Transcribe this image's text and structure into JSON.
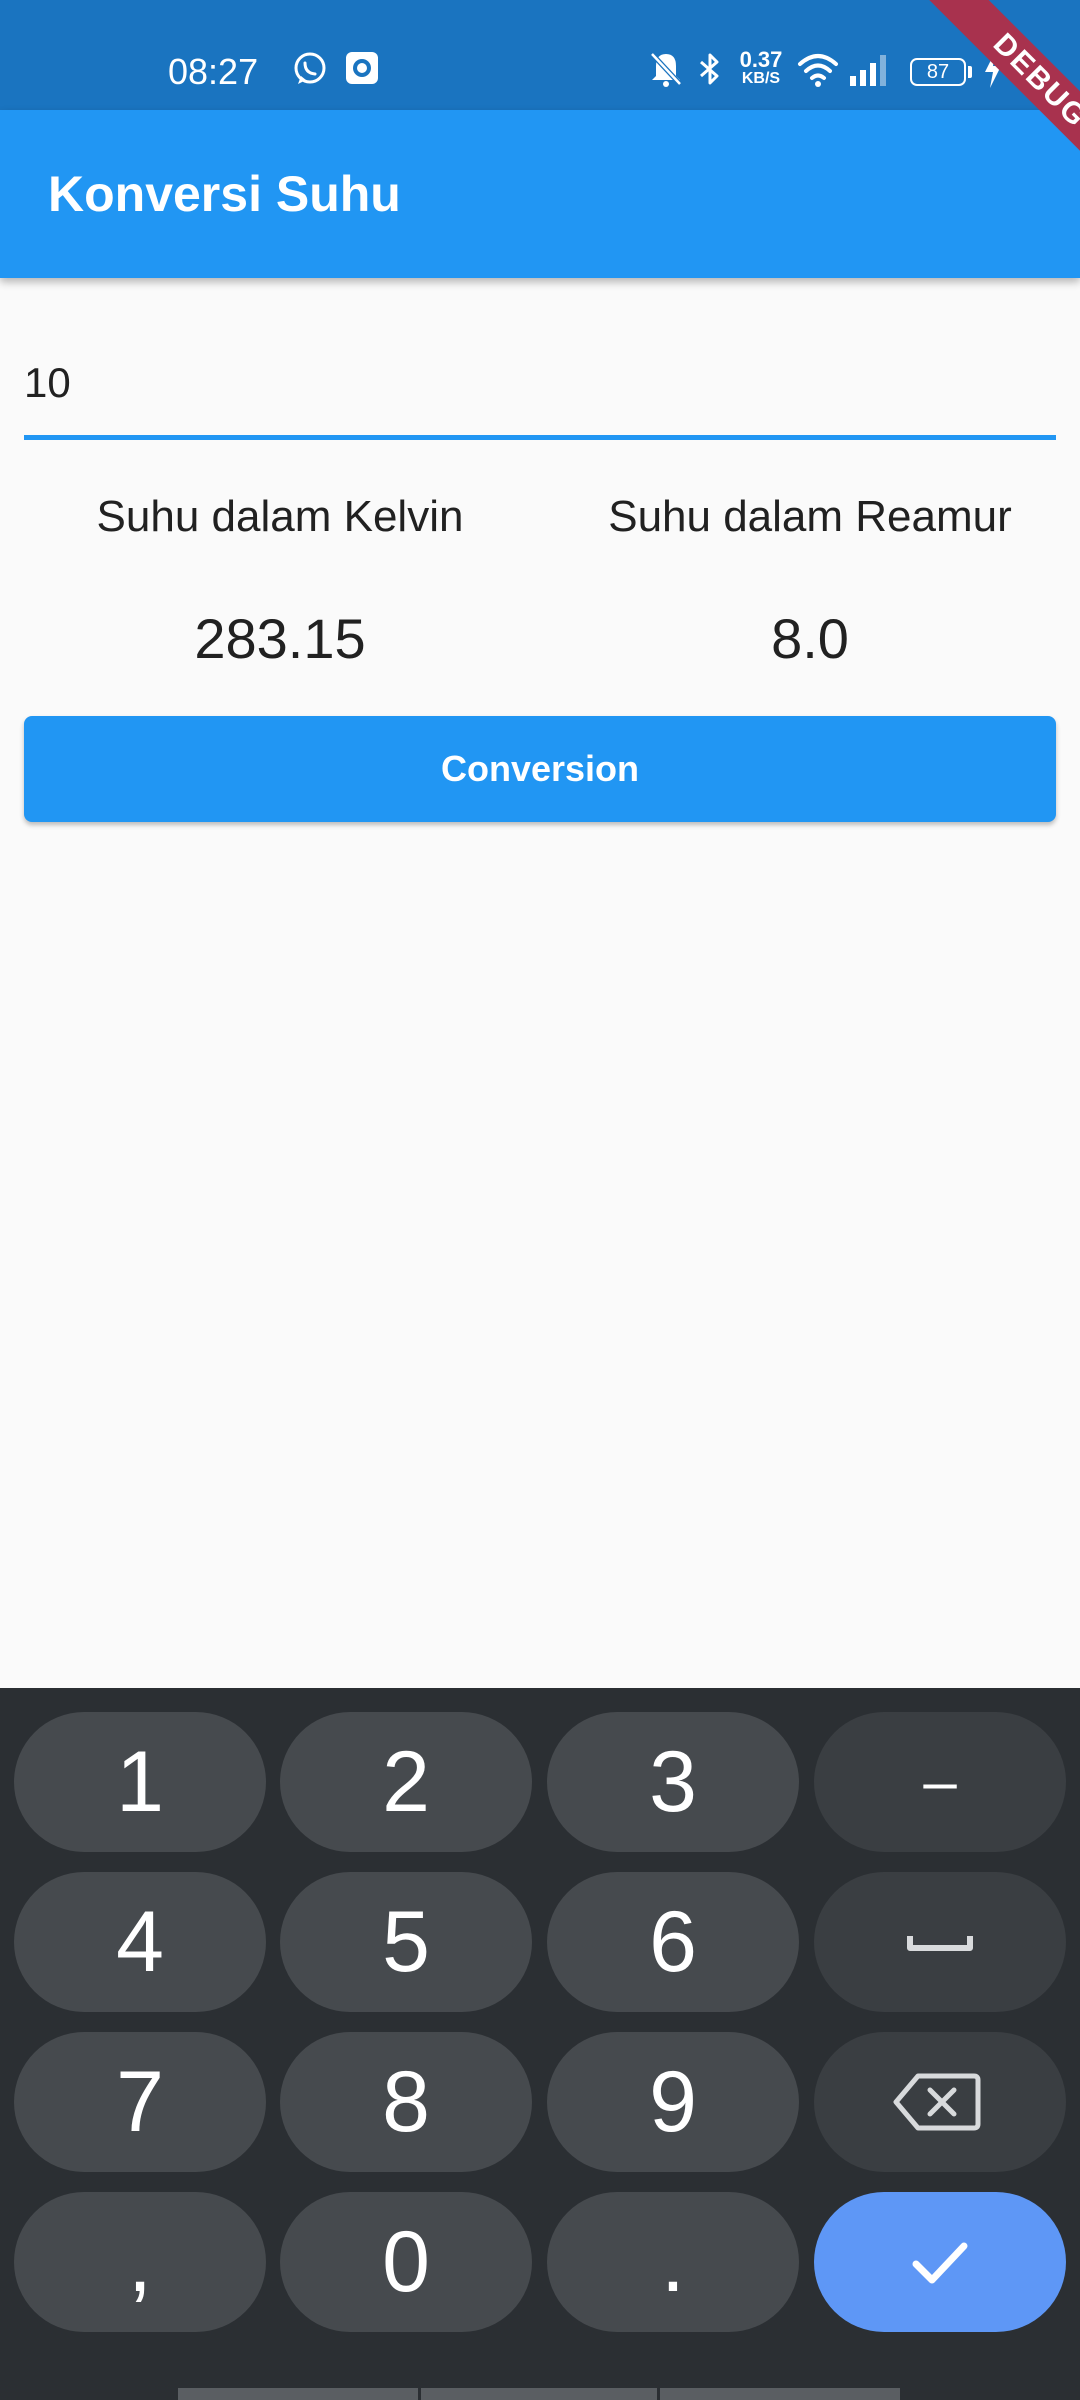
{
  "status_bar": {
    "time": "08:27",
    "speed_value": "0.37",
    "speed_unit": "KB/S",
    "battery": "87",
    "icons": [
      "whatsapp-icon",
      "screen-record-icon",
      "mute-icon",
      "bluetooth-icon",
      "wifi-icon",
      "signal-icon",
      "battery-icon",
      "charging-icon"
    ]
  },
  "debug_banner": "DEBUG",
  "app_bar": {
    "title": "Konversi Suhu"
  },
  "input": {
    "value": "10"
  },
  "results": {
    "kelvin_label": "Suhu dalam Kelvin",
    "kelvin_value": "283.15",
    "reamur_label": "Suhu dalam Reamur",
    "reamur_value": "8.0"
  },
  "convert_button_label": "Conversion",
  "keyboard": {
    "keys": {
      "k1": "1",
      "k2": "2",
      "k3": "3",
      "minus": "–",
      "k4": "4",
      "k5": "5",
      "k6": "6",
      "k7": "7",
      "k8": "8",
      "k9": "9",
      "comma": ",",
      "k0": "0",
      "period": "."
    },
    "icons": [
      "space-icon",
      "backspace-icon",
      "check-icon"
    ]
  },
  "colors": {
    "status_bar": "#1a74c0",
    "app_bar": "#2196f3",
    "button": "#2196f3",
    "underline": "#2196f3",
    "debug_banner": "#a8324e",
    "keyboard_bg": "#2b2f33",
    "key": "#464a4e",
    "key_function": "#3a3e42",
    "key_done": "#5e97f6"
  }
}
